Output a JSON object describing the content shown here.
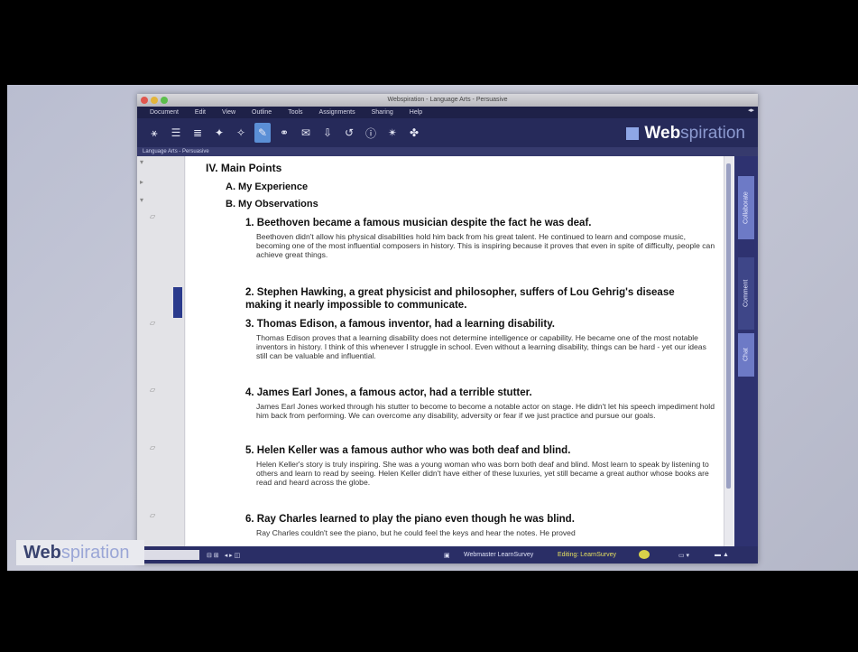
{
  "brand": {
    "web": "Web",
    "spiration": "spiration"
  },
  "window": {
    "title": "Webspiration - Language Arts - Persuasive",
    "menus": [
      "Document",
      "Edit",
      "View",
      "Outline",
      "Tools",
      "Assignments",
      "Sharing",
      "Help"
    ],
    "doc_tab": "Language Arts - Persuasive",
    "active_tool_label": "Note"
  },
  "outline": {
    "main_heading": "IV. Main Points",
    "sub_a": "A. My Experience",
    "sub_b": "B. My Observations",
    "points": [
      {
        "title": "1. Beethoven became a famous musician despite the fact he was deaf.",
        "note": "Beethoven didn't allow his physical disabilities hold him back from his great talent. He continued to learn and compose music, becoming one of the most influential composers in history. This is inspiring because it proves that even in spite of difficulty, people can achieve great things."
      },
      {
        "title": "2. Stephen Hawking, a great physicist and philosopher, suffers of Lou Gehrig's disease making it nearly impossible to communicate.",
        "note": ""
      },
      {
        "title": "3. Thomas Edison, a famous inventor, had a learning disability.",
        "note": "Thomas Edison proves that a learning disability does not determine intelligence or capability. He became one of the most notable inventors in history. I think of this whenever I struggle in school. Even without a learning disability, things can be hard - yet our ideas still can be valuable and influential."
      },
      {
        "title": "4. James Earl Jones, a famous actor, had a terrible stutter.",
        "note": "James Earl Jones worked through his stutter to become to become a notable actor on stage. He didn't let his speech impediment hold him back from performing. We can overcome any disability, adversity or fear if we just practice and pursue our goals."
      },
      {
        "title": "5. Helen Keller was a famous author who was both deaf and blind.",
        "note": "Helen Keller's story is truly inspiring. She was a young woman who was born both deaf and blind. Most learn to speak by listening to others and learn to read by seeing. Helen Keller didn't have either of these luxuries, yet still became a great author whose books are read and heard across the globe."
      },
      {
        "title": "6. Ray Charles learned to play the piano even though he was blind.",
        "note": "Ray Charles couldn't see the piano, but he could feel the keys and hear the notes. He proved"
      }
    ]
  },
  "side_tabs": [
    "Collaborate",
    "Comment",
    "Chat"
  ],
  "status": {
    "author": "Webmaster LearnSurvey",
    "editing": "Editing: LearnSurvey"
  }
}
